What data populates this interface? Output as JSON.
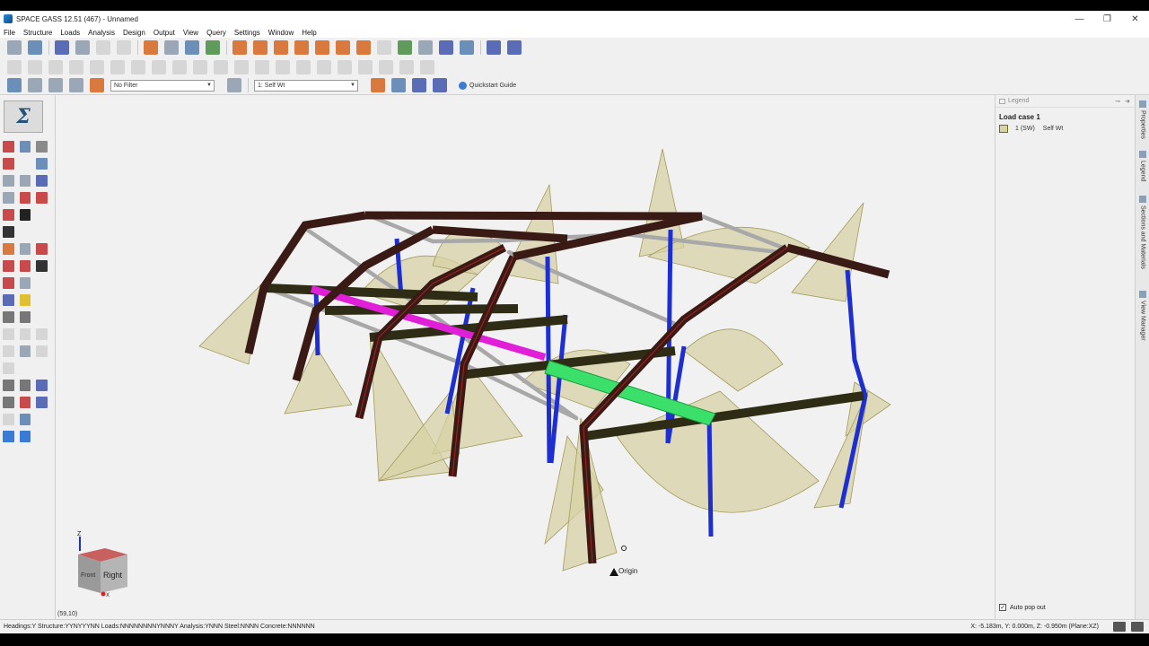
{
  "window": {
    "title": "SPACE GASS 12.51 (467) - Unnamed",
    "controls": {
      "minimize": "—",
      "restore": "❐",
      "close": "✕"
    }
  },
  "menu": [
    "File",
    "Structure",
    "Loads",
    "Analysis",
    "Design",
    "Output",
    "View",
    "Query",
    "Settings",
    "Window",
    "Help"
  ],
  "toolbar": {
    "filter_value": "No Filter",
    "loadcase_value": "1: Self Wt",
    "quickstart_label": "Quickstart Guide"
  },
  "viewport": {
    "cursor_coords": "(59,10)",
    "origin_label": "Origin",
    "viewcube": {
      "front": "Front",
      "right": "Right",
      "axis_z": "Z",
      "axis_x": "X"
    }
  },
  "legend": {
    "panel_title": "Legend",
    "load_case_title": "Load case 1",
    "items": [
      {
        "code": "1 (SW)",
        "name": "Self Wt"
      }
    ],
    "auto_pop_out": "Auto pop out"
  },
  "side_tabs": [
    "Properties",
    "Legend",
    "Sections and Materials",
    "View Manager"
  ],
  "status": {
    "left": "Headings:Y Structure:YYNYYYNN Loads:NNNNNNNNYNNNY Analysis:YNNN Steel:NNNN Concrete:NNNNNN",
    "right": "X: -5.183m, Y: 0.000m, Z: -0.950m (Plane:XZ)"
  },
  "colors": {
    "rafter": "#3a1a14",
    "rafter_edge": "#b02020",
    "column_blue": "#1e2fd1",
    "purlin_gray": "#a8a8a8",
    "beam_dark": "#2e2c14",
    "magenta": "#e21fd8",
    "green": "#3be06a",
    "moment_fill": "#d7d1a3"
  }
}
